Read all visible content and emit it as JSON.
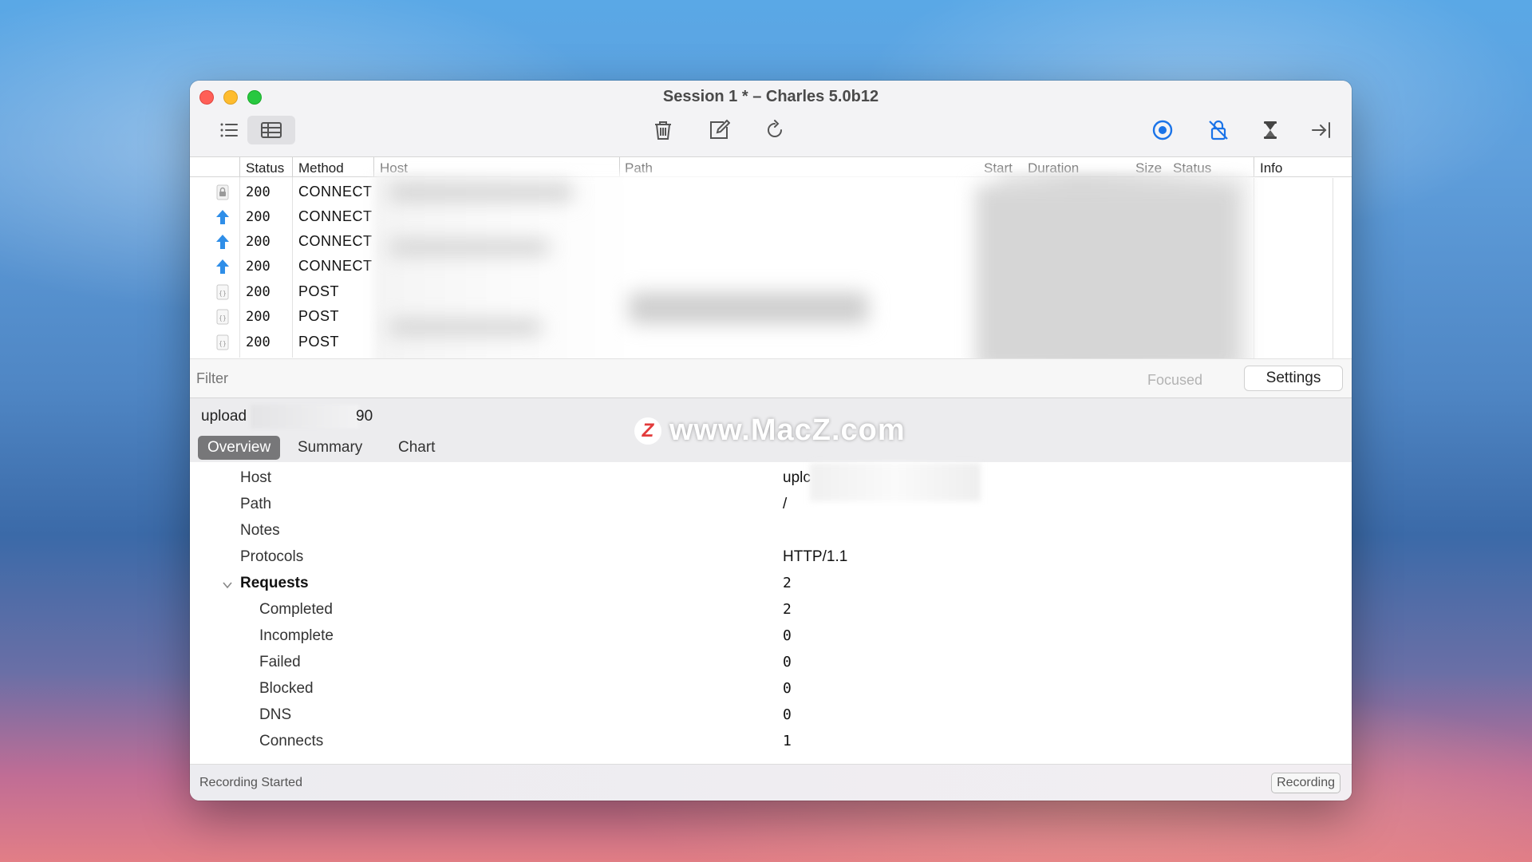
{
  "window": {
    "title": "Session 1 * – Charles 5.0b12"
  },
  "toolbar": {
    "left": [
      {
        "icon": "list-view-icon"
      },
      {
        "icon": "table-view-icon"
      }
    ],
    "center": [
      {
        "icon": "trash-icon"
      },
      {
        "icon": "edit-icon"
      },
      {
        "icon": "refresh-icon"
      }
    ],
    "right": [
      {
        "icon": "record-icon",
        "color": "#1a73e8"
      },
      {
        "icon": "ssl-proxy-icon",
        "color": "#1a73e8"
      },
      {
        "icon": "throttle-icon"
      },
      {
        "icon": "expand-right-icon"
      }
    ]
  },
  "table": {
    "columns": [
      "Status",
      "Method",
      "Host",
      "Path",
      "Start",
      "Duration",
      "Size",
      "Status",
      "Info"
    ],
    "rows": [
      {
        "icon": "lock-icon",
        "status": "200",
        "method": "CONNECT"
      },
      {
        "icon": "upload-arrow-icon",
        "status": "200",
        "method": "CONNECT"
      },
      {
        "icon": "upload-arrow-icon",
        "status": "200",
        "method": "CONNECT"
      },
      {
        "icon": "upload-arrow-icon",
        "status": "200",
        "method": "CONNECT"
      },
      {
        "icon": "json-doc-icon",
        "status": "200",
        "method": "POST"
      },
      {
        "icon": "json-doc-icon",
        "status": "200",
        "method": "POST"
      },
      {
        "icon": "json-doc-icon",
        "status": "200",
        "method": "POST"
      }
    ]
  },
  "filter": {
    "placeholder": "Filter",
    "focused_label": "Focused",
    "settings_label": "Settings"
  },
  "detail": {
    "title_prefix": "upload",
    "title_suffix": "90",
    "tabs": [
      "Overview",
      "Summary",
      "Chart"
    ],
    "active_tab": "Overview",
    "properties": [
      {
        "key": "Host",
        "value": "uplc"
      },
      {
        "key": "Path",
        "value": "/"
      },
      {
        "key": "Notes",
        "value": ""
      },
      {
        "key": "Protocols",
        "value": "HTTP/1.1"
      },
      {
        "key": "Requests",
        "value": "2"
      },
      {
        "key": "Completed",
        "value": "2"
      },
      {
        "key": "Incomplete",
        "value": "0"
      },
      {
        "key": "Failed",
        "value": "0"
      },
      {
        "key": "Blocked",
        "value": "0"
      },
      {
        "key": "DNS",
        "value": "0"
      },
      {
        "key": "Connects",
        "value": "1"
      }
    ]
  },
  "status_bar": {
    "text": "Recording Started",
    "button_label": "Recording"
  },
  "watermark": {
    "logo": "Z",
    "text": "www.MacZ.com"
  }
}
